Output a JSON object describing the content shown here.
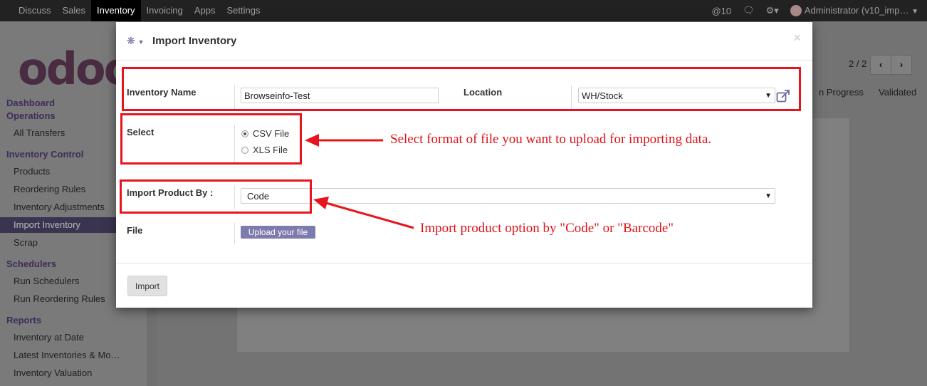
{
  "topbar": {
    "nav": [
      "Discuss",
      "Sales",
      "Inventory",
      "Invoicing",
      "Apps",
      "Settings"
    ],
    "active": "Inventory",
    "mentions": "@10",
    "user": "Administrator (v10_imp…"
  },
  "sidebar": {
    "logo": "odoo",
    "items": [
      {
        "label": "Dashboard",
        "type": "header"
      },
      {
        "label": "Operations",
        "type": "header"
      },
      {
        "label": "All Transfers",
        "type": "item"
      },
      {
        "label": "Inventory Control",
        "type": "header"
      },
      {
        "label": "Products",
        "type": "item"
      },
      {
        "label": "Reordering Rules",
        "type": "item"
      },
      {
        "label": "Inventory Adjustments",
        "type": "item"
      },
      {
        "label": "Import Inventory",
        "type": "item",
        "selected": true
      },
      {
        "label": "Scrap",
        "type": "item"
      },
      {
        "label": "Schedulers",
        "type": "header"
      },
      {
        "label": "Run Schedulers",
        "type": "item"
      },
      {
        "label": "Run Reordering Rules",
        "type": "item"
      },
      {
        "label": "Reports",
        "type": "header"
      },
      {
        "label": "Inventory at Date",
        "type": "item"
      },
      {
        "label": "Latest Inventories & Mo…",
        "type": "item"
      },
      {
        "label": "Inventory Valuation",
        "type": "item"
      }
    ]
  },
  "background": {
    "pager": "2 / 2",
    "status_in_progress": "n Progress",
    "status_validated": "Validated"
  },
  "modal": {
    "title": "Import Inventory",
    "close": "×",
    "inventory_name_label": "Inventory Name",
    "inventory_name_value": "Browseinfo-Test",
    "location_label": "Location",
    "location_value": "WH/Stock",
    "select_label": "Select",
    "radio_csv": "CSV File",
    "radio_xls": "XLS File",
    "selected_format": "CSV File",
    "import_by_label": "Import Product By :",
    "import_by_value": "Code",
    "file_label": "File",
    "upload_button": "Upload your file",
    "import_button": "Import"
  },
  "annotations": {
    "note_select": "Select format of file you want to upload for importing data.",
    "note_import_by": "Import product option by \"Code\" or \"Barcode\""
  },
  "colors": {
    "annotation_red": "#e8141d",
    "upload_button": "#7c7bad",
    "topbar": "#222222"
  }
}
